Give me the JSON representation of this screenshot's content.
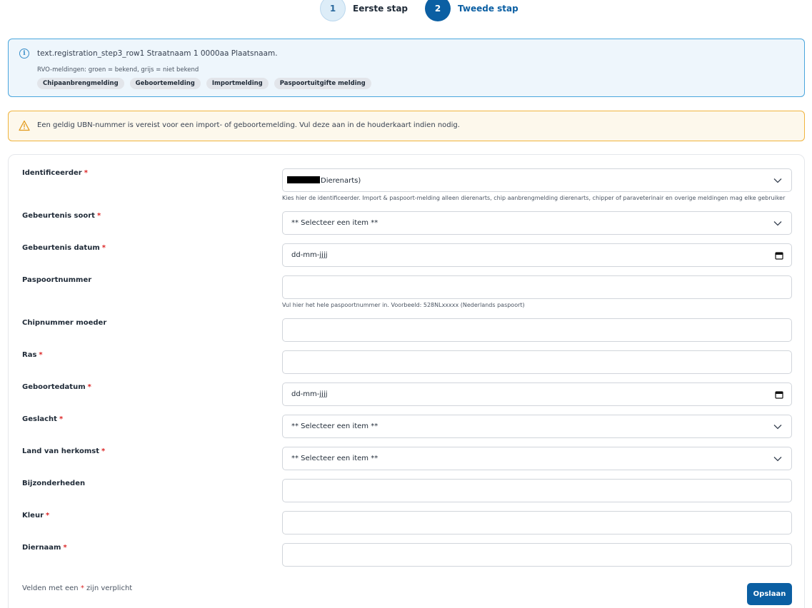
{
  "stepper": {
    "steps": [
      {
        "number": "1",
        "label": "Eerste stap",
        "state": "inactive"
      },
      {
        "number": "2",
        "label": "Tweede stap",
        "state": "active"
      }
    ]
  },
  "info": {
    "text": "text.registration_step3_row1 Straatnaam 1 0000aa Plaatsnaam.",
    "subtext": "RVO-meldingen: groen = bekend, grijs = niet bekend",
    "tags": [
      "Chipaanbrengmelding",
      "Geboortemelding",
      "Importmelding",
      "Paspoortuitgifte melding"
    ]
  },
  "warning": {
    "text": "Een geldig UBN-nummer is vereist voor een import- of geboortemelding. Vul deze aan in de houderkaart indien nodig."
  },
  "form": {
    "identificeerder": {
      "label": "Identificeerder",
      "value": "Dierenarts)",
      "help": "Kies hier de identificeerder. Import & paspoort-melding alleen dierenarts, chip aanbrengmelding dierenarts, chipper of paraveterinair en overige meldingen mag elke gebruiker"
    },
    "gebeurtenis_soort": {
      "label": "Gebeurtenis soort",
      "value": "** Selecteer een item **"
    },
    "gebeurtenis_datum": {
      "label": "Gebeurtenis datum",
      "value": "dd-mm-jjjj"
    },
    "paspoortnummer": {
      "label": "Paspoortnummer",
      "value": "",
      "help": "Vul hier het hele paspoortnummer in. Voorbeeld: 528NLxxxxx (Nederlands paspoort)"
    },
    "chipnummer_moeder": {
      "label": "Chipnummer moeder",
      "value": ""
    },
    "ras": {
      "label": "Ras",
      "value": ""
    },
    "geboortedatum": {
      "label": "Geboortedatum",
      "value": "dd-mm-jjjj"
    },
    "geslacht": {
      "label": "Geslacht",
      "value": "** Selecteer een item **"
    },
    "land_van_herkomst": {
      "label": "Land van herkomst",
      "value": "** Selecteer een item **"
    },
    "bijzonderheden": {
      "label": "Bijzonderheden",
      "value": ""
    },
    "kleur": {
      "label": "Kleur",
      "value": ""
    },
    "diernaam": {
      "label": "Diernaam",
      "value": ""
    },
    "required_marker": "*",
    "footer_prefix": "Velden met een",
    "footer_suffix": "zijn verplicht",
    "save_label": "Opslaan"
  },
  "colors": {
    "primary": "#0b5fa3",
    "info_border": "#4aa6dd",
    "warning_border": "#f0b43f",
    "required": "#dc2626"
  }
}
